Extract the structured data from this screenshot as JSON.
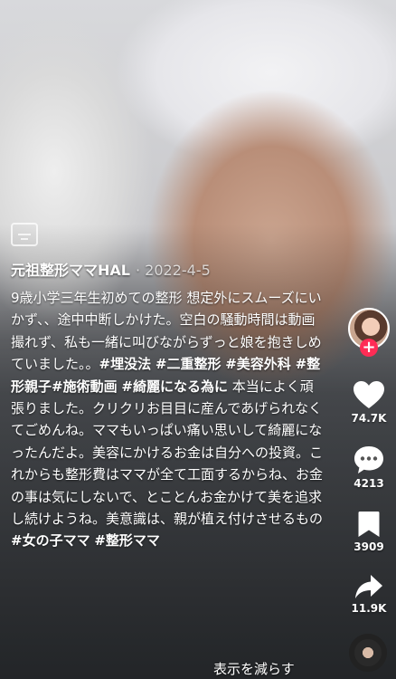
{
  "author": {
    "name": "元祖整形ママHAL",
    "date_text": "· 2022-4-5"
  },
  "description": [
    {
      "t": "text",
      "v": "9歳小学三年生初めての整形  想定外にスムーズにいかず、、途中中断しかけた。空白の騒動時間は動画撮れず、私も一緒に叫びながらずっと娘を抱きしめていました。。"
    },
    {
      "t": "tag",
      "v": "#埋没法"
    },
    {
      "t": "text",
      "v": " "
    },
    {
      "t": "tag",
      "v": "#二重整形"
    },
    {
      "t": "text",
      "v": " "
    },
    {
      "t": "tag",
      "v": "#美容外科"
    },
    {
      "t": "text",
      "v": " "
    },
    {
      "t": "tag",
      "v": "#整形親子"
    },
    {
      "t": "tag",
      "v": "#施術動画"
    },
    {
      "t": "text",
      "v": " "
    },
    {
      "t": "tag",
      "v": "#綺麗になる為に"
    },
    {
      "t": "text",
      "v": " 本当によく頑張りました。クリクリお目目に産んであげられなくてごめんね。ママもいっぱい痛い思いして綺麗になったんだよ。美容にかけるお金は自分への投資。これからも整形費はママが全て工面するからね、お金の事は気にしないで、とことんお金かけて美を追求し続けようね。美意識は、親が植え付けさせるもの "
    },
    {
      "t": "tag",
      "v": "#女の子ママ"
    },
    {
      "t": "text",
      "v": " "
    },
    {
      "t": "tag",
      "v": "#整形ママ"
    }
  ],
  "see_less_label": "表示を減らす",
  "actions": {
    "follow_symbol": "+",
    "likes": "74.7K",
    "comments": "4213",
    "saves": "3909",
    "shares": "11.9K"
  },
  "icons": {
    "captions": "captions-icon",
    "like": "heart-icon",
    "comment": "comment-bubble-icon",
    "save": "bookmark-icon",
    "share": "share-arrow-icon",
    "sound": "sound-disc-icon"
  },
  "colors": {
    "follow": "#fe2c55",
    "text": "#ffffff"
  }
}
